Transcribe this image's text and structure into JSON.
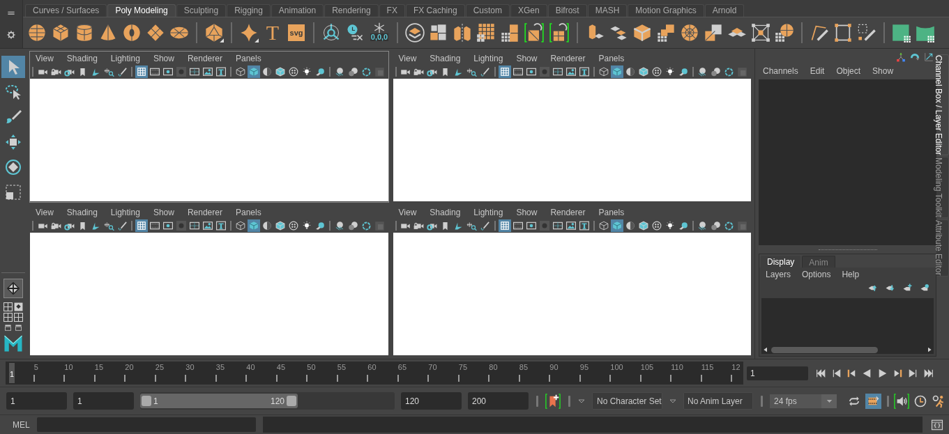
{
  "shelf": {
    "tabs": [
      {
        "label": "Curves / Surfaces",
        "selected": false
      },
      {
        "label": "Poly Modeling",
        "selected": true
      },
      {
        "label": "Sculpting",
        "selected": false
      },
      {
        "label": "Rigging",
        "selected": false
      },
      {
        "label": "Animation",
        "selected": false
      },
      {
        "label": "Rendering",
        "selected": false
      },
      {
        "label": "FX",
        "selected": false
      },
      {
        "label": "FX Caching",
        "selected": false
      },
      {
        "label": "Custom",
        "selected": false
      },
      {
        "label": "XGen",
        "selected": false
      },
      {
        "label": "Bifrost",
        "selected": false
      },
      {
        "label": "MASH",
        "selected": false
      },
      {
        "label": "Motion Graphics",
        "selected": false
      },
      {
        "label": "Arnold",
        "selected": false
      }
    ],
    "type_icon_text": "T",
    "svg_icon_text": "svg",
    "freeze_icon_text": "0,0,0"
  },
  "tools": [
    {
      "kind": "select",
      "selected": true
    },
    {
      "kind": "lasso",
      "selected": false
    },
    {
      "kind": "paint",
      "selected": false
    },
    {
      "kind": "move",
      "selected": false
    },
    {
      "kind": "rotate",
      "selected": false
    },
    {
      "kind": "scale",
      "selected": false
    }
  ],
  "viewports": [
    {
      "active": true,
      "menus": [
        "View",
        "Shading",
        "Lighting",
        "Show",
        "Renderer",
        "Panels"
      ],
      "toggles": [
        {
          "kind": "grid",
          "on": true
        },
        {
          "kind": "film-gate",
          "on": false
        },
        {
          "kind": "resolution-gate",
          "on": false
        },
        {
          "kind": "gate-mask",
          "on": false
        },
        {
          "kind": "field-chart",
          "on": false
        },
        {
          "kind": "safe-action",
          "on": false
        },
        {
          "kind": "safe-title",
          "on": false
        },
        {
          "kind": "wireframe",
          "on": false
        },
        {
          "kind": "smooth-shade",
          "on": true
        },
        {
          "kind": "default-material",
          "on": false
        },
        {
          "kind": "wire-on-shaded",
          "on": false
        },
        {
          "kind": "textured",
          "on": false
        },
        {
          "kind": "lighting",
          "on": false
        },
        {
          "kind": "shadows",
          "on": false
        }
      ]
    },
    {
      "active": false,
      "menus": [
        "View",
        "Shading",
        "Lighting",
        "Show",
        "Renderer",
        "Panels"
      ],
      "toggles": [
        {
          "kind": "grid",
          "on": true
        },
        {
          "kind": "film-gate",
          "on": false
        },
        {
          "kind": "resolution-gate",
          "on": false
        },
        {
          "kind": "gate-mask",
          "on": false
        },
        {
          "kind": "field-chart",
          "on": false
        },
        {
          "kind": "safe-action",
          "on": false
        },
        {
          "kind": "safe-title",
          "on": false
        },
        {
          "kind": "wireframe",
          "on": false
        },
        {
          "kind": "smooth-shade",
          "on": true
        },
        {
          "kind": "default-material",
          "on": false
        },
        {
          "kind": "wire-on-shaded",
          "on": false
        },
        {
          "kind": "textured",
          "on": false
        },
        {
          "kind": "lighting",
          "on": false
        },
        {
          "kind": "shadows",
          "on": false
        }
      ]
    },
    {
      "active": false,
      "menus": [
        "View",
        "Shading",
        "Lighting",
        "Show",
        "Renderer",
        "Panels"
      ],
      "toggles": [
        {
          "kind": "grid",
          "on": true
        },
        {
          "kind": "film-gate",
          "on": false
        },
        {
          "kind": "resolution-gate",
          "on": false
        },
        {
          "kind": "gate-mask",
          "on": false
        },
        {
          "kind": "field-chart",
          "on": false
        },
        {
          "kind": "safe-action",
          "on": false
        },
        {
          "kind": "safe-title",
          "on": false
        },
        {
          "kind": "wireframe",
          "on": false
        },
        {
          "kind": "smooth-shade",
          "on": true
        },
        {
          "kind": "default-material",
          "on": false
        },
        {
          "kind": "wire-on-shaded",
          "on": false
        },
        {
          "kind": "textured",
          "on": false
        },
        {
          "kind": "lighting",
          "on": false
        },
        {
          "kind": "shadows",
          "on": false
        }
      ]
    },
    {
      "active": false,
      "menus": [
        "View",
        "Shading",
        "Lighting",
        "Show",
        "Renderer",
        "Panels"
      ],
      "toggles": [
        {
          "kind": "grid",
          "on": true
        },
        {
          "kind": "film-gate",
          "on": false
        },
        {
          "kind": "resolution-gate",
          "on": false
        },
        {
          "kind": "gate-mask",
          "on": false
        },
        {
          "kind": "field-chart",
          "on": false
        },
        {
          "kind": "safe-action",
          "on": false
        },
        {
          "kind": "safe-title",
          "on": false
        },
        {
          "kind": "wireframe",
          "on": false
        },
        {
          "kind": "smooth-shade",
          "on": true
        },
        {
          "kind": "default-material",
          "on": false
        },
        {
          "kind": "wire-on-shaded",
          "on": false
        },
        {
          "kind": "textured",
          "on": false
        },
        {
          "kind": "lighting",
          "on": false
        },
        {
          "kind": "shadows",
          "on": false
        }
      ]
    }
  ],
  "channel_box": {
    "menus": [
      "Channels",
      "Edit",
      "Object",
      "Show"
    ]
  },
  "layer_editor": {
    "tabs": [
      {
        "label": "Display",
        "selected": true
      },
      {
        "label": "Anim",
        "selected": false
      }
    ],
    "menus": [
      "Layers",
      "Options",
      "Help"
    ]
  },
  "side_tabs": [
    {
      "label": "Channel Box / Layer Editor",
      "selected": true
    },
    {
      "label": "Modeling Toolkit",
      "selected": false
    },
    {
      "label": "Attribute Editor",
      "selected": false
    }
  ],
  "timeline": {
    "labels": [
      "5",
      "10",
      "15",
      "20",
      "25",
      "30",
      "35",
      "40",
      "45",
      "50",
      "55",
      "60",
      "65",
      "70",
      "75",
      "80",
      "85",
      "90",
      "95",
      "100",
      "105",
      "110",
      "115",
      "12"
    ],
    "current_frame": "1",
    "level": 0,
    "current_frame_field": "1"
  },
  "range": {
    "start_time": "1",
    "playback_start": "1",
    "slider_start": "1",
    "slider_end": "120",
    "playback_end": "120",
    "end_time": "200",
    "character_set": "No Character Set",
    "anim_layer": "No Anim Layer",
    "fps": "24 fps",
    "cache_on": true
  },
  "command_line": {
    "language": "MEL"
  }
}
